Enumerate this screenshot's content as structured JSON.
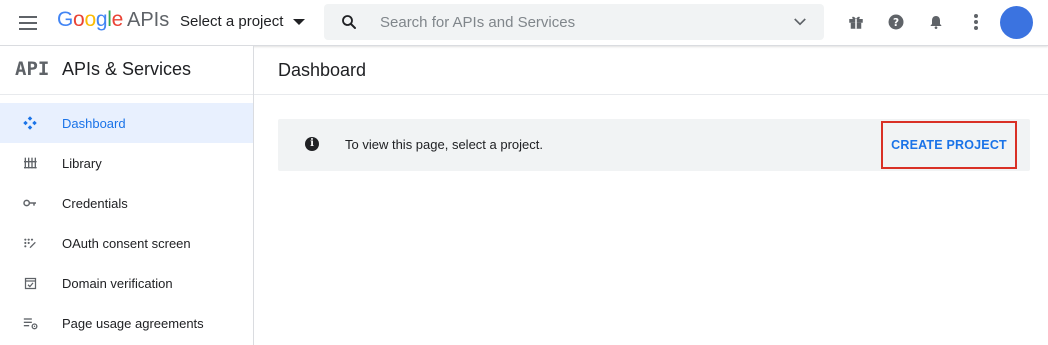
{
  "topbar": {
    "logo": {
      "word": "Google",
      "product": "APIs"
    },
    "project_selector": "Select a project",
    "search": {
      "placeholder": "Search for APIs and Services"
    },
    "icons": [
      "menu-icon",
      "gift-icon",
      "help-icon",
      "notifications-icon",
      "more-vert-icon",
      "avatar"
    ]
  },
  "sidebar": {
    "mark": "API",
    "title": "APIs & Services",
    "items": [
      {
        "label": "Dashboard",
        "icon": "dashboard-icon",
        "active": true
      },
      {
        "label": "Library",
        "icon": "library-icon",
        "active": false
      },
      {
        "label": "Credentials",
        "icon": "key-icon",
        "active": false
      },
      {
        "label": "OAuth consent screen",
        "icon": "oauth-consent-icon",
        "active": false
      },
      {
        "label": "Domain verification",
        "icon": "domain-verification-icon",
        "active": false
      },
      {
        "label": "Page usage agreements",
        "icon": "settings-list-icon",
        "active": false
      }
    ]
  },
  "main": {
    "title": "Dashboard",
    "banner": {
      "message": "To view this page, select a project.",
      "action": "CREATE PROJECT"
    }
  },
  "colors": {
    "accent": "#1a73e8",
    "active_bg": "#e8f0fe",
    "highlight_border": "#d93025",
    "banner_bg": "#f1f3f4",
    "avatar": "#3b73e0"
  }
}
